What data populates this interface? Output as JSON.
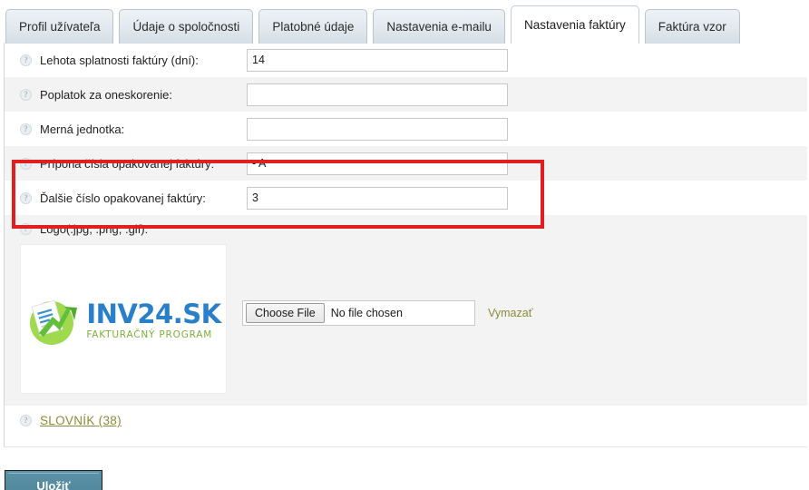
{
  "tabs": [
    {
      "label": "Profil užívateľa",
      "active": false
    },
    {
      "label": "Údaje o spoločnosti",
      "active": false
    },
    {
      "label": "Platobné údaje",
      "active": false
    },
    {
      "label": "Nastavenia e-mailu",
      "active": false
    },
    {
      "label": "Nastavenia faktúry",
      "active": true
    },
    {
      "label": "Faktúra vzor",
      "active": false
    }
  ],
  "form": {
    "rows": [
      {
        "label": "Lehota splatnosti faktúry (dní):",
        "value": "14",
        "placeholder": ""
      },
      {
        "label": "Poplatok za oneskorenie:",
        "value": "",
        "placeholder": ""
      },
      {
        "label": "Merná jednotka:",
        "value": "",
        "placeholder": ""
      },
      {
        "label": "Prípona čísla opakovanej faktúry:",
        "value": "- A",
        "placeholder": ""
      },
      {
        "label": "Ďalšie číslo opakovanej faktúry:",
        "value": "3",
        "placeholder": ""
      }
    ],
    "help_glyph": "?"
  },
  "logo_section": {
    "label": "Logo(.jpg, .png, .gif):",
    "logo_title": "INV24.SK",
    "logo_subtitle": "FAKTURAČNÝ PROGRAM",
    "choose_file_label": "Choose File",
    "no_file_text": "No file chosen",
    "clear_label": "Vymazať"
  },
  "footer": {
    "dictionary_label": "SLOVNÍK (38)",
    "save_label": "Uložiť"
  },
  "colors": {
    "highlight_box": "#e02020",
    "link": "#8a8a3a",
    "logo_blue": "#2a7fc9",
    "logo_green": "#7fae3d",
    "save_button": "#4d8499",
    "row_alt": "#f3f3f3"
  }
}
